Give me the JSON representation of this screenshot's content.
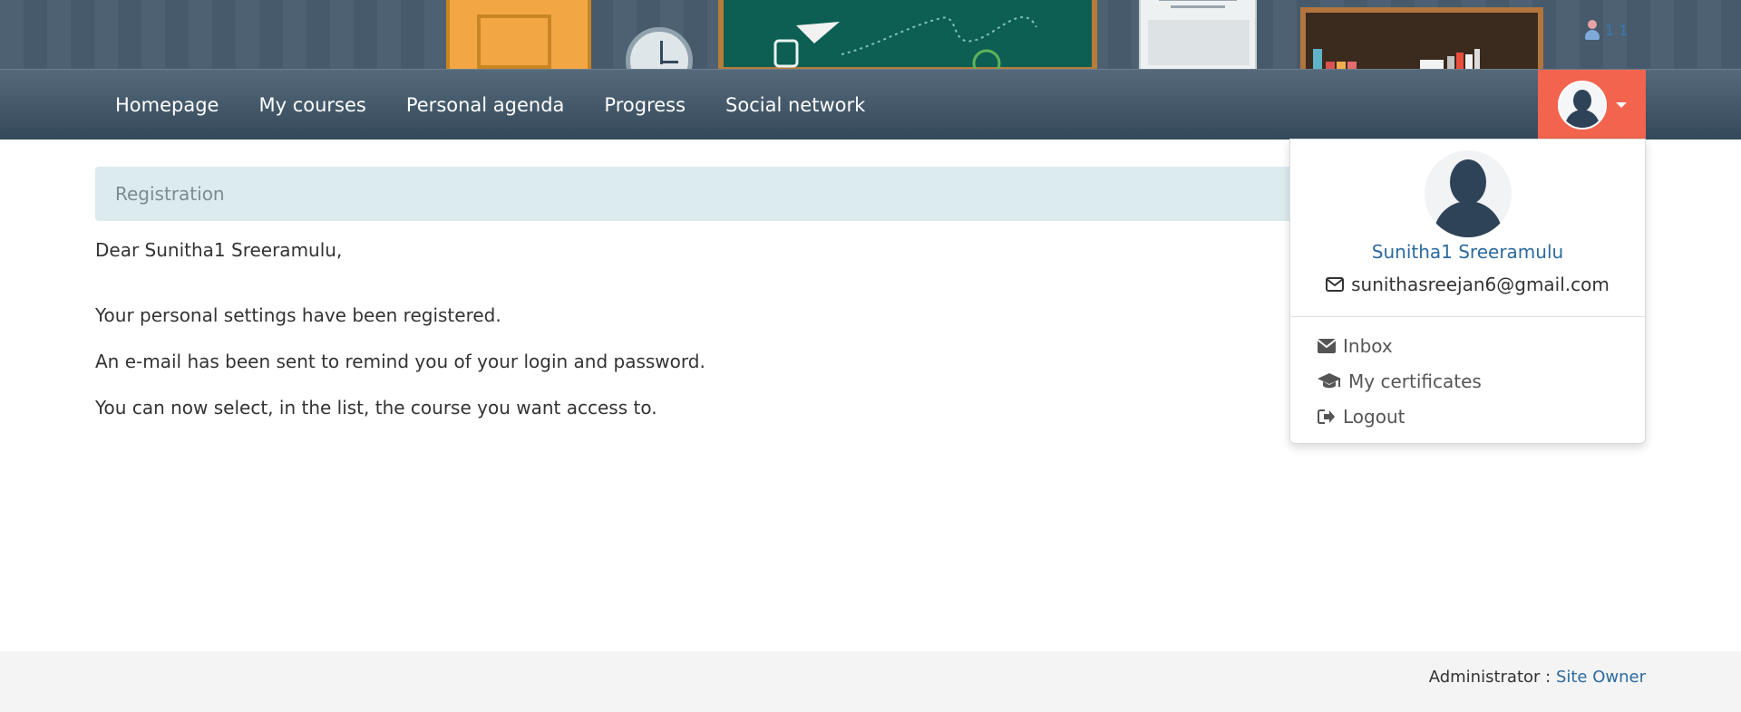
{
  "banner": {
    "user_count_text": "1 1"
  },
  "nav": {
    "items": [
      {
        "label": "Homepage"
      },
      {
        "label": "My courses"
      },
      {
        "label": "Personal agenda"
      },
      {
        "label": "Progress"
      },
      {
        "label": "Social network"
      }
    ]
  },
  "main": {
    "section_title": "Registration",
    "greeting": "Dear Sunitha1 Sreeramulu,",
    "lines": [
      "Your personal settings have been registered.",
      "An e-mail has been sent to remind you of your login and password.",
      "You can now select, in the list, the course you want access to."
    ]
  },
  "user_menu": {
    "name": "Sunitha1 Sreeramulu",
    "email": "sunithasreejan6@gmail.com",
    "items": [
      {
        "label": "Inbox",
        "icon": "envelope-icon"
      },
      {
        "label": "My certificates",
        "icon": "graduation-cap-icon"
      },
      {
        "label": "Logout",
        "icon": "sign-out-icon"
      }
    ]
  },
  "footer": {
    "admin_label": "Administrator : ",
    "admin_link": "Site Owner"
  },
  "colors": {
    "nav_bg": "#3f5466",
    "user_toggle": "#f2644e",
    "section_bar": "#dcebee",
    "link": "#2c6aa0"
  }
}
